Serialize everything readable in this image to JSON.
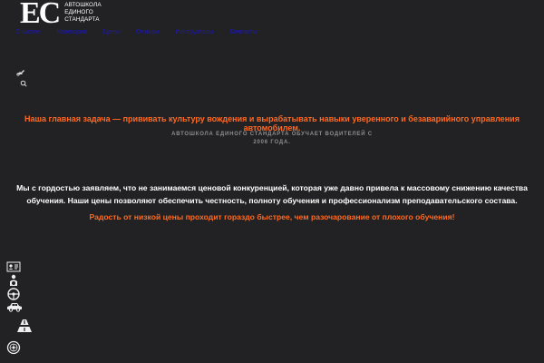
{
  "logo": {
    "mark": "EC",
    "line1": "АВТОШКОЛА",
    "line2": "ЕДИНОГО",
    "line3": "СТАНДАРТА"
  },
  "nav": {
    "items": [
      {
        "label": "О школе"
      },
      {
        "label": "Категории"
      },
      {
        "label": "Цены"
      },
      {
        "label": "Отзывы"
      },
      {
        "label": "Инструкторы"
      },
      {
        "label": "Контакты"
      }
    ]
  },
  "side_icons": [
    "car-key-icon",
    "search-icon"
  ],
  "main": {
    "headline": "Наша главная задача — прививать культуру вождения и вырабатывать навыки уверенного и безаварийного управления автомобилем.",
    "subline": "АВТОШКОЛА ЕДИНОГО СТАНДАРТА ОБУЧАЕТ ВОДИТЕЛЕЙ С 2006 ГОДА.",
    "paragraph": "Мы с гордостью заявляем, что не занимаемся ценовой конкуренцией, которая уже давно привела к массовому снижению качества обучения. Наши цены позволяют обеспечить честность, полноту обучения и профессионализм преподавательского состава.",
    "accent": "Радость от низкой цены проходит гораздо быстрее, чем разочарование от плохого обучения!"
  },
  "bottom_icons": [
    "id-card-icon",
    "driver-icon",
    "steering-wheel-icon",
    "car-icon",
    "road-icon",
    "wheel-icon"
  ],
  "colors": {
    "background": "#222123",
    "accent": "#ff6a22",
    "nav_link": "#1d1ab8",
    "muted": "#8e8e8e"
  }
}
